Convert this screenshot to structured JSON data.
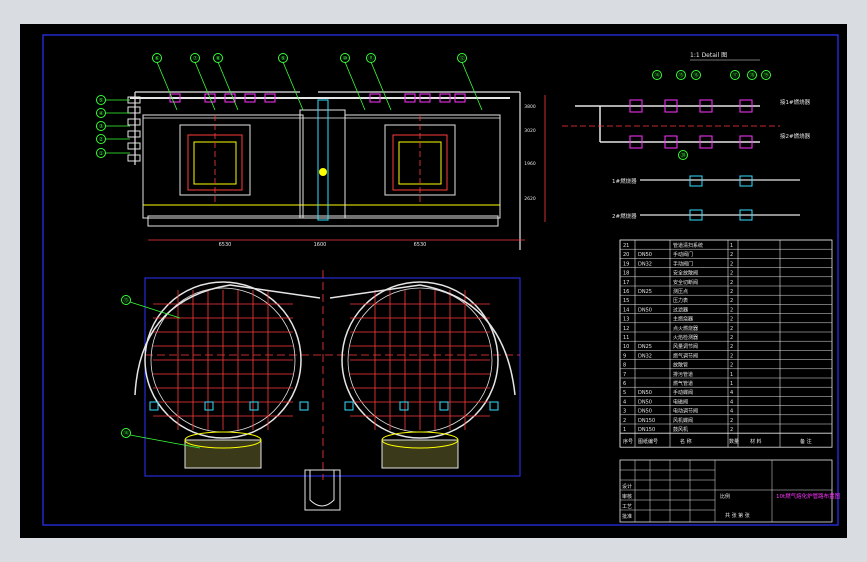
{
  "viewer": {
    "background": "#d9dde2"
  },
  "drawing": {
    "background": "#000000",
    "colors": {
      "frame": "#2c33ff",
      "pipe": "#e5e5e5",
      "red": "#ff3b3b",
      "yellow": "#ffff00",
      "green": "#39ff39",
      "magenta": "#ff33ff",
      "cyan": "#33e0ff",
      "white": "#ffffff"
    },
    "balloons_front": [
      "⑥",
      "⑦",
      "⑧",
      "⑨",
      "⑩",
      "⑪",
      "⑫"
    ],
    "balloons_left": [
      "⑤",
      "④",
      "③",
      "②",
      "①"
    ],
    "balloons_plan": [
      "⑬",
      "⑭"
    ],
    "balloons_detail": [
      "⑭",
      "⑮",
      "⑯",
      "⑰",
      "⑱",
      "⑲",
      "⑳"
    ],
    "detail_title": "1:1 Detail 图",
    "detail_labels": [
      "接1#燃烧器",
      "接2#燃烧器",
      "1#燃烧器",
      "2#燃烧器"
    ],
    "dimensions_front": [
      "6530",
      "1600",
      "6530"
    ],
    "dimensions_right": [
      "3800",
      "3020",
      "1960",
      "2620"
    ],
    "bom_rows": [
      {
        "no": "21",
        "code": "",
        "name": "管道清扫系统",
        "qty": "1"
      },
      {
        "no": "20",
        "code": "DN50",
        "name": "手动阀门",
        "qty": "2"
      },
      {
        "no": "19",
        "code": "DN32",
        "name": "手动阀门",
        "qty": "2"
      },
      {
        "no": "18",
        "code": "",
        "name": "安全放散阀",
        "qty": "2"
      },
      {
        "no": "17",
        "code": "",
        "name": "安全切断阀",
        "qty": "2"
      },
      {
        "no": "16",
        "code": "DN25",
        "name": "测压点",
        "qty": "2"
      },
      {
        "no": "15",
        "code": "",
        "name": "压力表",
        "qty": "2"
      },
      {
        "no": "14",
        "code": "DN50",
        "name": "过滤器",
        "qty": "2"
      },
      {
        "no": "13",
        "code": "",
        "name": "主燃烧器",
        "qty": "2"
      },
      {
        "no": "12",
        "code": "",
        "name": "点火燃烧器",
        "qty": "2"
      },
      {
        "no": "11",
        "code": "",
        "name": "火焰检测器",
        "qty": "2"
      },
      {
        "no": "10",
        "code": "DN25",
        "name": "风量调节阀",
        "qty": "2"
      },
      {
        "no": "9",
        "code": "DN32",
        "name": "燃气调节阀",
        "qty": "2"
      },
      {
        "no": "8",
        "code": "",
        "name": "放散管",
        "qty": "2"
      },
      {
        "no": "7",
        "code": "",
        "name": "排污管道",
        "qty": "1"
      },
      {
        "no": "6",
        "code": "",
        "name": "燃气管道",
        "qty": "1"
      },
      {
        "no": "5",
        "code": "DN50",
        "name": "手动蝶阀",
        "qty": "4"
      },
      {
        "no": "4",
        "code": "DN50",
        "name": "电磁阀",
        "qty": "4"
      },
      {
        "no": "3",
        "code": "DN50",
        "name": "电动调节阀",
        "qty": "4"
      },
      {
        "no": "2",
        "code": "DN150",
        "name": "风机蝶阀",
        "qty": "2"
      },
      {
        "no": "1",
        "code": "DN150",
        "name": "鼓风机",
        "qty": "2"
      }
    ],
    "bom_header": {
      "no": "序号",
      "code": "图纸编号",
      "name": "名 称",
      "qty": "数量",
      "material": "材 料",
      "note": "备 注"
    },
    "title_block": {
      "title": "10t燃气熔化炉管路布置图",
      "rows": [
        "设计",
        "审核",
        "工艺",
        "批准"
      ],
      "scale_label": "比例",
      "sheet_label": "共 张 第 张"
    }
  }
}
